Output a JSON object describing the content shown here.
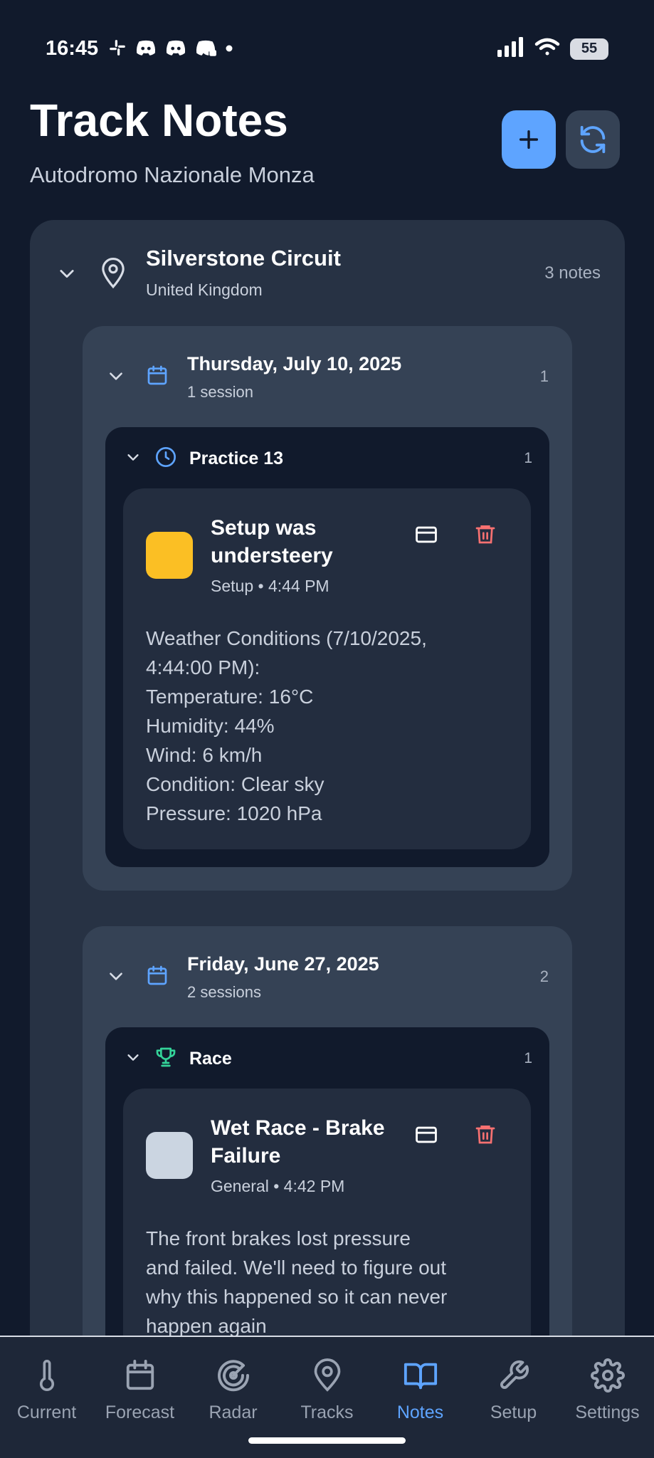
{
  "status_bar": {
    "time": "16:45",
    "battery": "55",
    "left_icons": [
      "slack-icon",
      "discord-icon",
      "discord-icon",
      "discord-game-icon",
      "dot-icon"
    ],
    "right_icons": [
      "signal-icon",
      "wifi-icon",
      "battery-icon"
    ]
  },
  "header": {
    "title": "Track Notes",
    "subtitle": "Autodromo Nazionale Monza",
    "add_icon": "plus-icon",
    "refresh_icon": "refresh-icon"
  },
  "track": {
    "name": "Silverstone Circuit",
    "country": "United Kingdom",
    "count": "3 notes",
    "days": [
      {
        "title": "Thursday, July 10, 2025",
        "sub": "1 session",
        "count": "1",
        "sessions": [
          {
            "title": "Practice 13",
            "count": "1",
            "icon": "clock-icon",
            "notes": [
              {
                "title": "Setup was understeery",
                "meta": "Setup • 4:44 PM",
                "swatch": "#fbbf24",
                "body_lines": [
                  "Weather Conditions (7/10/2025,",
                  "4:44:00 PM):",
                  "Temperature: 16°C",
                  "Humidity: 44%",
                  "Wind: 6 km/h",
                  "Condition: Clear sky",
                  "Pressure: 1020 hPa"
                ]
              }
            ]
          }
        ]
      },
      {
        "title": "Friday, June 27, 2025",
        "sub": "2 sessions",
        "count": "2",
        "sessions": [
          {
            "title": "Race",
            "count": "1",
            "icon": "trophy-icon",
            "notes": [
              {
                "title": "Wet Race - Brake Failure",
                "meta": "General • 4:42 PM",
                "swatch": "#cbd5e1",
                "body_lines": [
                  "The front brakes lost pressure",
                  "and failed. We'll need to figure out",
                  "why this happened so it can never",
                  "happen again"
                ]
              }
            ]
          }
        ]
      }
    ]
  },
  "nav": {
    "active": "Notes",
    "items": [
      {
        "label": "Current",
        "icon": "thermometer-icon"
      },
      {
        "label": "Forecast",
        "icon": "calendar-icon"
      },
      {
        "label": "Radar",
        "icon": "radar-icon"
      },
      {
        "label": "Tracks",
        "icon": "map-pin-icon"
      },
      {
        "label": "Notes",
        "icon": "book-icon"
      },
      {
        "label": "Setup",
        "icon": "wrench-icon"
      },
      {
        "label": "Settings",
        "icon": "gear-icon"
      }
    ]
  },
  "colors": {
    "accent": "#5ea4ff",
    "delete": "#f87171",
    "race_icon": "#34d399",
    "background": "#111a2c"
  }
}
